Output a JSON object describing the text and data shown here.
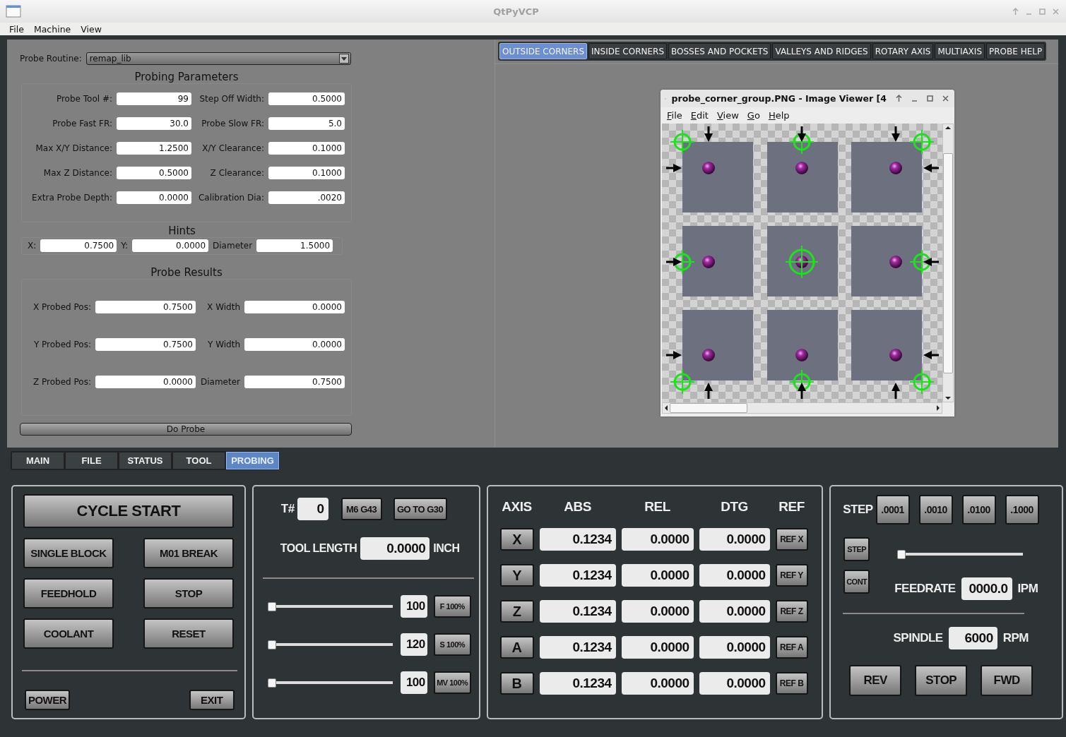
{
  "window": {
    "title": "QtPyVCP"
  },
  "menu": [
    "File",
    "Machine",
    "View"
  ],
  "probe_routine": {
    "label": "Probe Routine:",
    "value": "remap_lib"
  },
  "probing_parameters": {
    "title": "Probing Parameters",
    "rows": [
      [
        {
          "label": "Probe Tool #:",
          "value": "99"
        },
        {
          "label": "Step Off Width:",
          "value": "0.5000"
        }
      ],
      [
        {
          "label": "Probe Fast FR:",
          "value": "30.0"
        },
        {
          "label": "Probe Slow FR:",
          "value": "5.0"
        }
      ],
      [
        {
          "label": "Max X/Y Distance:",
          "value": "1.2500"
        },
        {
          "label": "X/Y Clearance:",
          "value": "0.1000"
        }
      ],
      [
        {
          "label": "Max Z Distance:",
          "value": "0.5000"
        },
        {
          "label": "Z Clearance:",
          "value": "0.1000"
        }
      ],
      [
        {
          "label": "Extra Probe Depth:",
          "value": "0.0000"
        },
        {
          "label": "Calibration Dia:",
          "value": ".0020"
        }
      ]
    ]
  },
  "hints": {
    "title": "Hints",
    "fields": [
      {
        "label": "X:",
        "value": "0.7500"
      },
      {
        "label": "Y:",
        "value": "0.0000"
      },
      {
        "label": "Diameter",
        "value": "1.5000"
      }
    ]
  },
  "probe_results": {
    "title": "Probe Results",
    "rows": [
      [
        {
          "label": "X Probed Pos:",
          "value": "0.7500"
        },
        {
          "label": "X Width",
          "value": "0.0000"
        }
      ],
      [
        {
          "label": "Y Probed Pos:",
          "value": "0.7500"
        },
        {
          "label": "Y Width",
          "value": "0.0000"
        }
      ],
      [
        {
          "label": "Z Probed Pos:",
          "value": "0.0000"
        },
        {
          "label": "Diameter",
          "value": "0.7500"
        }
      ]
    ]
  },
  "do_probe": "Do Probe",
  "probe_tabs": [
    {
      "label": "OUTSIDE CORNERS",
      "selected": true
    },
    {
      "label": "INSIDE CORNERS",
      "selected": false
    },
    {
      "label": "BOSSES AND POCKETS",
      "selected": false
    },
    {
      "label": "VALLEYS AND RIDGES",
      "selected": false
    },
    {
      "label": "ROTARY AXIS",
      "selected": false
    },
    {
      "label": "MULTIAXIS",
      "selected": false
    },
    {
      "label": "PROBE HELP",
      "selected": false
    }
  ],
  "image_viewer": {
    "title": "probe_corner_group.PNG - Image Viewer [4",
    "menu": [
      "File",
      "Edit",
      "View",
      "Go",
      "Help"
    ]
  },
  "main_tabs": [
    {
      "label": "MAIN",
      "selected": false
    },
    {
      "label": "FILE",
      "selected": false
    },
    {
      "label": "STATUS",
      "selected": false
    },
    {
      "label": "TOOL",
      "selected": false
    },
    {
      "label": "PROBING",
      "selected": true
    }
  ],
  "cycle_panel": {
    "cycle_start": "CYCLE START",
    "buttons": [
      "SINGLE BLOCK",
      "M01 BREAK",
      "FEEDHOLD",
      "STOP",
      "COOLANT",
      "RESET"
    ],
    "power": "POWER",
    "exit": "EXIT"
  },
  "tool_panel": {
    "tool_label": "T#",
    "tool_value": "0",
    "buttons": [
      "M6 G43",
      "GO TO G30"
    ],
    "length_label": "TOOL LENGTH",
    "length_value": "0.0000",
    "length_unit": "INCH",
    "overrides": [
      {
        "level": 0,
        "value": "100",
        "button": "F 100%"
      },
      {
        "level": 0,
        "value": "120",
        "button": "S 100%"
      },
      {
        "level": 0,
        "value": "100",
        "button": "MV 100%"
      }
    ]
  },
  "dro": {
    "columns": [
      "AXIS",
      "ABS",
      "REL",
      "DTG",
      "REF"
    ],
    "rows": [
      {
        "axis": "X",
        "abs": "0.1234",
        "rel": "0.0000",
        "dtg": "0.0000",
        "ref": "REF X"
      },
      {
        "axis": "Y",
        "abs": "0.1234",
        "rel": "0.0000",
        "dtg": "0.0000",
        "ref": "REF Y"
      },
      {
        "axis": "Z",
        "abs": "0.1234",
        "rel": "0.0000",
        "dtg": "0.0000",
        "ref": "REF Z"
      },
      {
        "axis": "A",
        "abs": "0.1234",
        "rel": "0.0000",
        "dtg": "0.0000",
        "ref": "REF A"
      },
      {
        "axis": "B",
        "abs": "0.1234",
        "rel": "0.0000",
        "dtg": "0.0000",
        "ref": "REF B"
      }
    ]
  },
  "jog": {
    "step_label": "STEP",
    "steps": [
      ".0001",
      ".0010",
      ".0100",
      ".1000"
    ],
    "modes": [
      "STEP",
      "CONT"
    ],
    "level": 0,
    "feedrate_label": "FEEDRATE",
    "feedrate": "0000.0",
    "feedrate_unit": "IPM",
    "spindle_label": "SPINDLE",
    "spindle": "6000",
    "spindle_unit": "RPM",
    "spindle_buttons": [
      "REV",
      "STOP",
      "FWD"
    ]
  }
}
